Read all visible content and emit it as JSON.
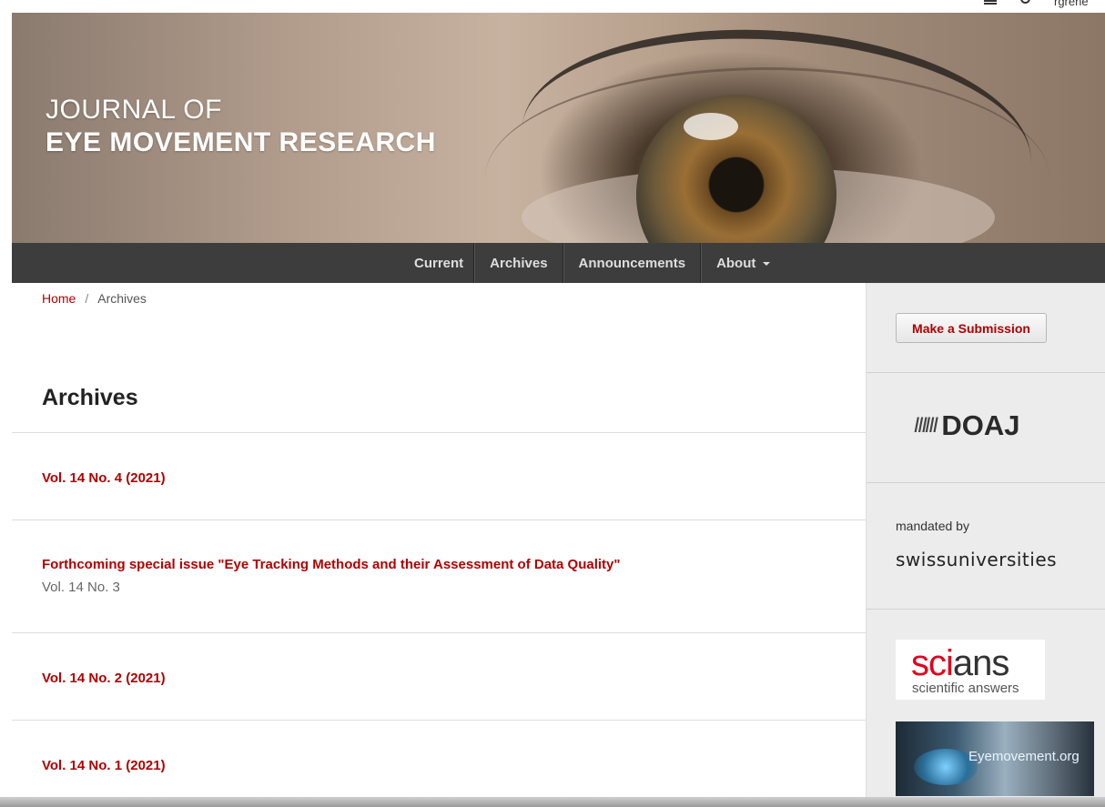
{
  "topbar": {
    "user_label": "rgrene"
  },
  "header": {
    "title_line1": "JOURNAL OF",
    "title_line2": "EYE MOVEMENT RESEARCH"
  },
  "nav": {
    "items": [
      {
        "label": "Current"
      },
      {
        "label": "Archives"
      },
      {
        "label": "Announcements"
      },
      {
        "label": "About"
      }
    ]
  },
  "breadcrumb": {
    "home": "Home",
    "separator": "/",
    "current": "Archives"
  },
  "page_title": "Archives",
  "issues": [
    {
      "title": "Vol. 14 No. 4 (2021)",
      "subtitle": ""
    },
    {
      "title": "Forthcoming special issue \"Eye Tracking Methods and their Assessment of Data Quality\"",
      "subtitle": "Vol. 14 No. 3"
    },
    {
      "title": "Vol. 14 No. 2 (2021)",
      "subtitle": ""
    },
    {
      "title": "Vol. 14 No. 1 (2021)",
      "subtitle": ""
    }
  ],
  "sidebar": {
    "submit_label": "Make a Submission",
    "doaj_label": "DOAJ",
    "mandated_label": "mandated by",
    "swiss_label": "swissuniversities",
    "scians_name_red": "sci",
    "scians_name_rest": "ans",
    "scians_tagline": "scientific answers",
    "eyemovement_label": "Eyemovement.org"
  },
  "colors": {
    "link_red": "#b10000",
    "nav_bg": "#3d3d3d",
    "sidebar_bg": "#ececec"
  }
}
